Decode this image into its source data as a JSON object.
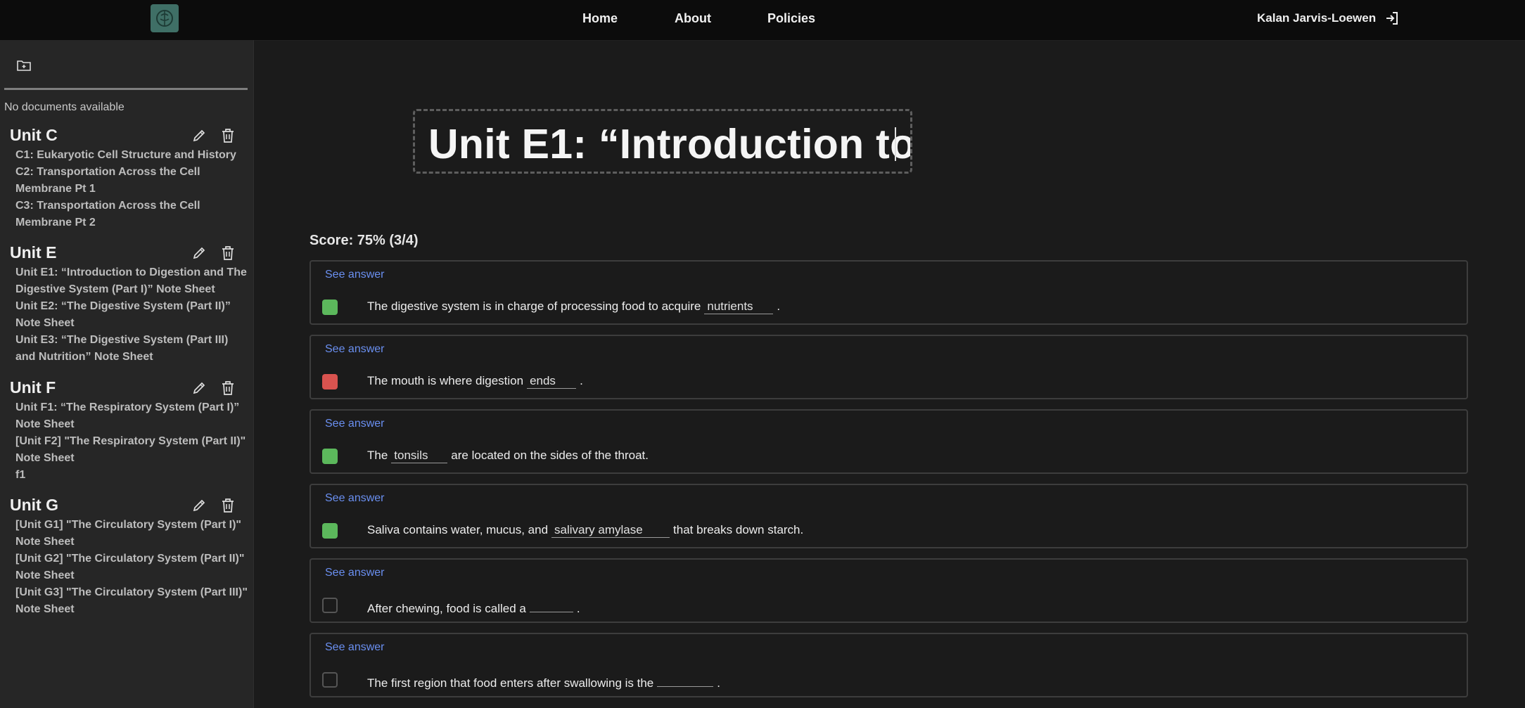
{
  "nav": {
    "logo_icon": "brain-logo-icon",
    "links": [
      "Home",
      "About",
      "Policies"
    ],
    "user_name": "Kalan Jarvis-Loewen",
    "signout_icon": "sign-in-icon"
  },
  "sidebar": {
    "new_folder_icon": "folder-plus-icon",
    "no_docs": "No documents available",
    "units": [
      {
        "title": "Unit C",
        "docs": [
          "C1: Eukaryotic Cell Structure and History",
          "C2: Transportation Across the Cell Membrane Pt 1",
          "C3: Transportation Across the Cell Membrane Pt 2"
        ]
      },
      {
        "title": "Unit E",
        "docs": [
          "Unit E1: “Introduction to Digestion and The Digestive System (Part I)” Note Sheet",
          "Unit E2: “The Digestive System (Part II)” Note Sheet",
          "Unit E3: “The Digestive System (Part III) and Nutrition” Note Sheet"
        ]
      },
      {
        "title": "Unit F",
        "docs": [
          "Unit F1: “The Respiratory System (Part I)” Note Sheet",
          "[Unit F2] \"The Respiratory System (Part II)\" Note Sheet",
          "f1"
        ]
      },
      {
        "title": "Unit G",
        "docs": [
          "[Unit G1] \"The Circulatory System (Part I)\" Note Sheet",
          "[Unit G2] \"The Circulatory System (Part II)\" Note Sheet",
          "[Unit G3] \"The Circulatory System (Part III)\" Note Sheet"
        ]
      }
    ]
  },
  "main": {
    "title": "Unit E1: “Introduction to ",
    "score": "Score: 75% (3/4)",
    "see_answer": "See answer",
    "colors": {
      "correct": "#5cb85c",
      "incorrect": "#d9534f",
      "accent": "#6a8ff0"
    },
    "questions": [
      {
        "status": "correct",
        "before": "The digestive system is in charge of processing food to acquire",
        "answer": "nutrients",
        "after": "."
      },
      {
        "status": "incorrect",
        "before": "The mouth is where digestion",
        "answer": "ends",
        "after": "."
      },
      {
        "status": "correct",
        "before": "The",
        "answer": "tonsils",
        "after": "are located on the sides of the throat."
      },
      {
        "status": "correct",
        "before": "Saliva contains water, mucus, and",
        "answer": "salivary amylase",
        "after": "that breaks down starch."
      },
      {
        "status": "unanswered",
        "before": "After chewing, food is called a",
        "answer": "",
        "after": "."
      },
      {
        "status": "unanswered",
        "before": "The first region that food enters after swallowing is the",
        "answer": "",
        "after": "."
      }
    ]
  }
}
